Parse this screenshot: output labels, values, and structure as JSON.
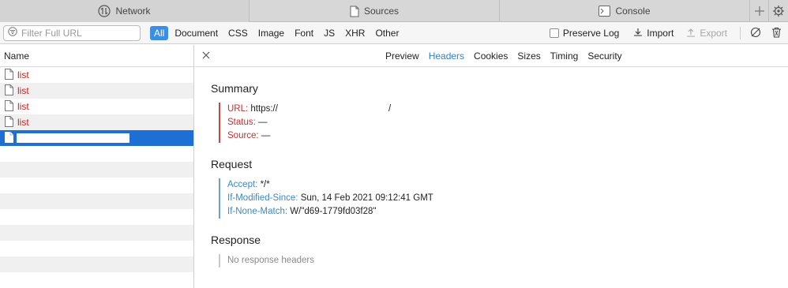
{
  "tabs": [
    {
      "label": "Network",
      "icon": "network-icon",
      "active": true
    },
    {
      "label": "Sources",
      "icon": "document-icon",
      "active": false
    },
    {
      "label": "Console",
      "icon": "console-icon",
      "active": false
    }
  ],
  "filter": {
    "placeholder": "Filter Full URL",
    "types": [
      "All",
      "Document",
      "CSS",
      "Image",
      "Font",
      "JS",
      "XHR",
      "Other"
    ],
    "active_type": "All",
    "preserve_log": "Preserve Log",
    "import": "Import",
    "export": "Export"
  },
  "list": {
    "header": "Name",
    "rows": [
      {
        "name": "list"
      },
      {
        "name": "list"
      },
      {
        "name": "list"
      },
      {
        "name": "list"
      },
      {
        "name": ""
      }
    ]
  },
  "detail": {
    "tabs": [
      "Preview",
      "Headers",
      "Cookies",
      "Sizes",
      "Timing",
      "Security"
    ],
    "active_tab": "Headers",
    "summary": {
      "title": "Summary",
      "url_key": "URL:",
      "url_value_prefix": "https://",
      "url_value_suffix": "/",
      "status_key": "Status:",
      "status_value": "—",
      "source_key": "Source:",
      "source_value": "—"
    },
    "request": {
      "title": "Request",
      "items": [
        {
          "key": "Accept:",
          "value": "*/*"
        },
        {
          "key": "If-Modified-Since:",
          "value": "Sun, 14 Feb 2021 09:12:41 GMT"
        },
        {
          "key": "If-None-Match:",
          "value": "W/\"d69-1779fd03f28\""
        }
      ]
    },
    "response": {
      "title": "Response",
      "empty": "No response headers"
    }
  },
  "colors": {
    "accent": "#3b8ee5",
    "selected_row": "#1d6fd6",
    "error_text": "#d0221f",
    "summary_key": "#c33030",
    "request_key": "#3d86c6"
  }
}
